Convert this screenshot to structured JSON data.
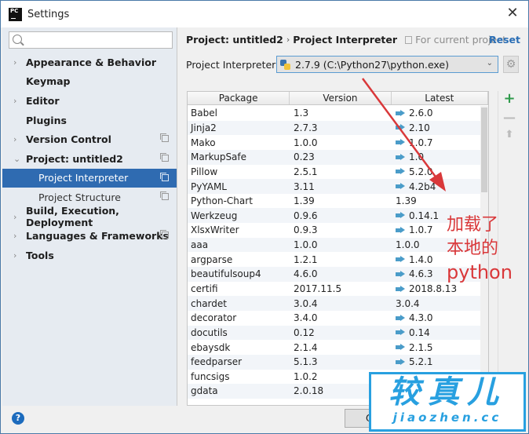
{
  "window": {
    "title": "Settings",
    "app_logo": "PC",
    "close_glyph": "✕"
  },
  "sidebar": {
    "search": {
      "value": "",
      "placeholder": ""
    },
    "items": [
      {
        "label": "Appearance & Behavior",
        "arrow": "›",
        "level": 0,
        "copy": false
      },
      {
        "label": "Keymap",
        "arrow": "",
        "level": 0,
        "copy": false
      },
      {
        "label": "Editor",
        "arrow": "›",
        "level": 0,
        "copy": false
      },
      {
        "label": "Plugins",
        "arrow": "",
        "level": 0,
        "copy": false
      },
      {
        "label": "Version Control",
        "arrow": "›",
        "level": 0,
        "copy": true
      },
      {
        "label": "Project: untitled2",
        "arrow": "⌄",
        "level": 0,
        "copy": true
      },
      {
        "label": "Project Interpreter",
        "arrow": "",
        "level": 1,
        "copy": true,
        "selected": true
      },
      {
        "label": "Project Structure",
        "arrow": "",
        "level": 1,
        "copy": true
      },
      {
        "label": "Build, Execution, Deployment",
        "arrow": "›",
        "level": 0,
        "copy": false
      },
      {
        "label": "Languages & Frameworks",
        "arrow": "›",
        "level": 0,
        "copy": true
      },
      {
        "label": "Tools",
        "arrow": "›",
        "level": 0,
        "copy": false
      }
    ]
  },
  "content": {
    "breadcrumb": [
      "Project: untitled2",
      "Project Interpreter"
    ],
    "breadcrumb_sep": "›",
    "scope_text": "For current project",
    "reset_label": "Reset",
    "interpreter_label": "Project Interpreter:",
    "interpreter_value": "2.7.9 (C:\\Python27\\python.exe)",
    "dropdown_glyph": "⌄",
    "gear_glyph": "⚙"
  },
  "packages": {
    "columns": [
      "Package",
      "Version",
      "Latest"
    ],
    "rows": [
      {
        "name": "Babel",
        "version": "1.3",
        "latest": "2.6.0",
        "upgrade": true
      },
      {
        "name": "Jinja2",
        "version": "2.7.3",
        "latest": "2.10",
        "upgrade": true
      },
      {
        "name": "Mako",
        "version": "1.0.0",
        "latest": "1.0.7",
        "upgrade": true
      },
      {
        "name": "MarkupSafe",
        "version": "0.23",
        "latest": "1.0",
        "upgrade": true
      },
      {
        "name": "Pillow",
        "version": "2.5.1",
        "latest": "5.2.0",
        "upgrade": true
      },
      {
        "name": "PyYAML",
        "version": "3.11",
        "latest": "4.2b4",
        "upgrade": true
      },
      {
        "name": "Python-Chart",
        "version": "1.39",
        "latest": "1.39",
        "upgrade": false
      },
      {
        "name": "Werkzeug",
        "version": "0.9.6",
        "latest": "0.14.1",
        "upgrade": true
      },
      {
        "name": "XlsxWriter",
        "version": "0.9.3",
        "latest": "1.0.7",
        "upgrade": true
      },
      {
        "name": "aaa",
        "version": "1.0.0",
        "latest": "1.0.0",
        "upgrade": false
      },
      {
        "name": "argparse",
        "version": "1.2.1",
        "latest": "1.4.0",
        "upgrade": true
      },
      {
        "name": "beautifulsoup4",
        "version": "4.6.0",
        "latest": "4.6.3",
        "upgrade": true
      },
      {
        "name": "certifi",
        "version": "2017.11.5",
        "latest": "2018.8.13",
        "upgrade": true
      },
      {
        "name": "chardet",
        "version": "3.0.4",
        "latest": "3.0.4",
        "upgrade": false
      },
      {
        "name": "decorator",
        "version": "3.4.0",
        "latest": "4.3.0",
        "upgrade": true
      },
      {
        "name": "docutils",
        "version": "0.12",
        "latest": "0.14",
        "upgrade": true
      },
      {
        "name": "ebaysdk",
        "version": "2.1.4",
        "latest": "2.1.5",
        "upgrade": true
      },
      {
        "name": "feedparser",
        "version": "5.1.3",
        "latest": "5.2.1",
        "upgrade": true
      },
      {
        "name": "funcsigs",
        "version": "1.0.2",
        "latest": "",
        "upgrade": false
      },
      {
        "name": "gdata",
        "version": "2.0.18",
        "latest": "",
        "upgrade": false
      }
    ],
    "tools": {
      "add": "+",
      "remove": "—",
      "upgrade": "⬆"
    }
  },
  "footer": {
    "help_glyph": "?",
    "ok_label": "OK"
  },
  "annotation": {
    "line1": "加载了",
    "line2": "本地的",
    "line3": "python",
    "color": "#d9383a"
  },
  "watermark": {
    "title": "较真儿",
    "url": "jiaozhen.cc",
    "color": "#28a0e0"
  }
}
